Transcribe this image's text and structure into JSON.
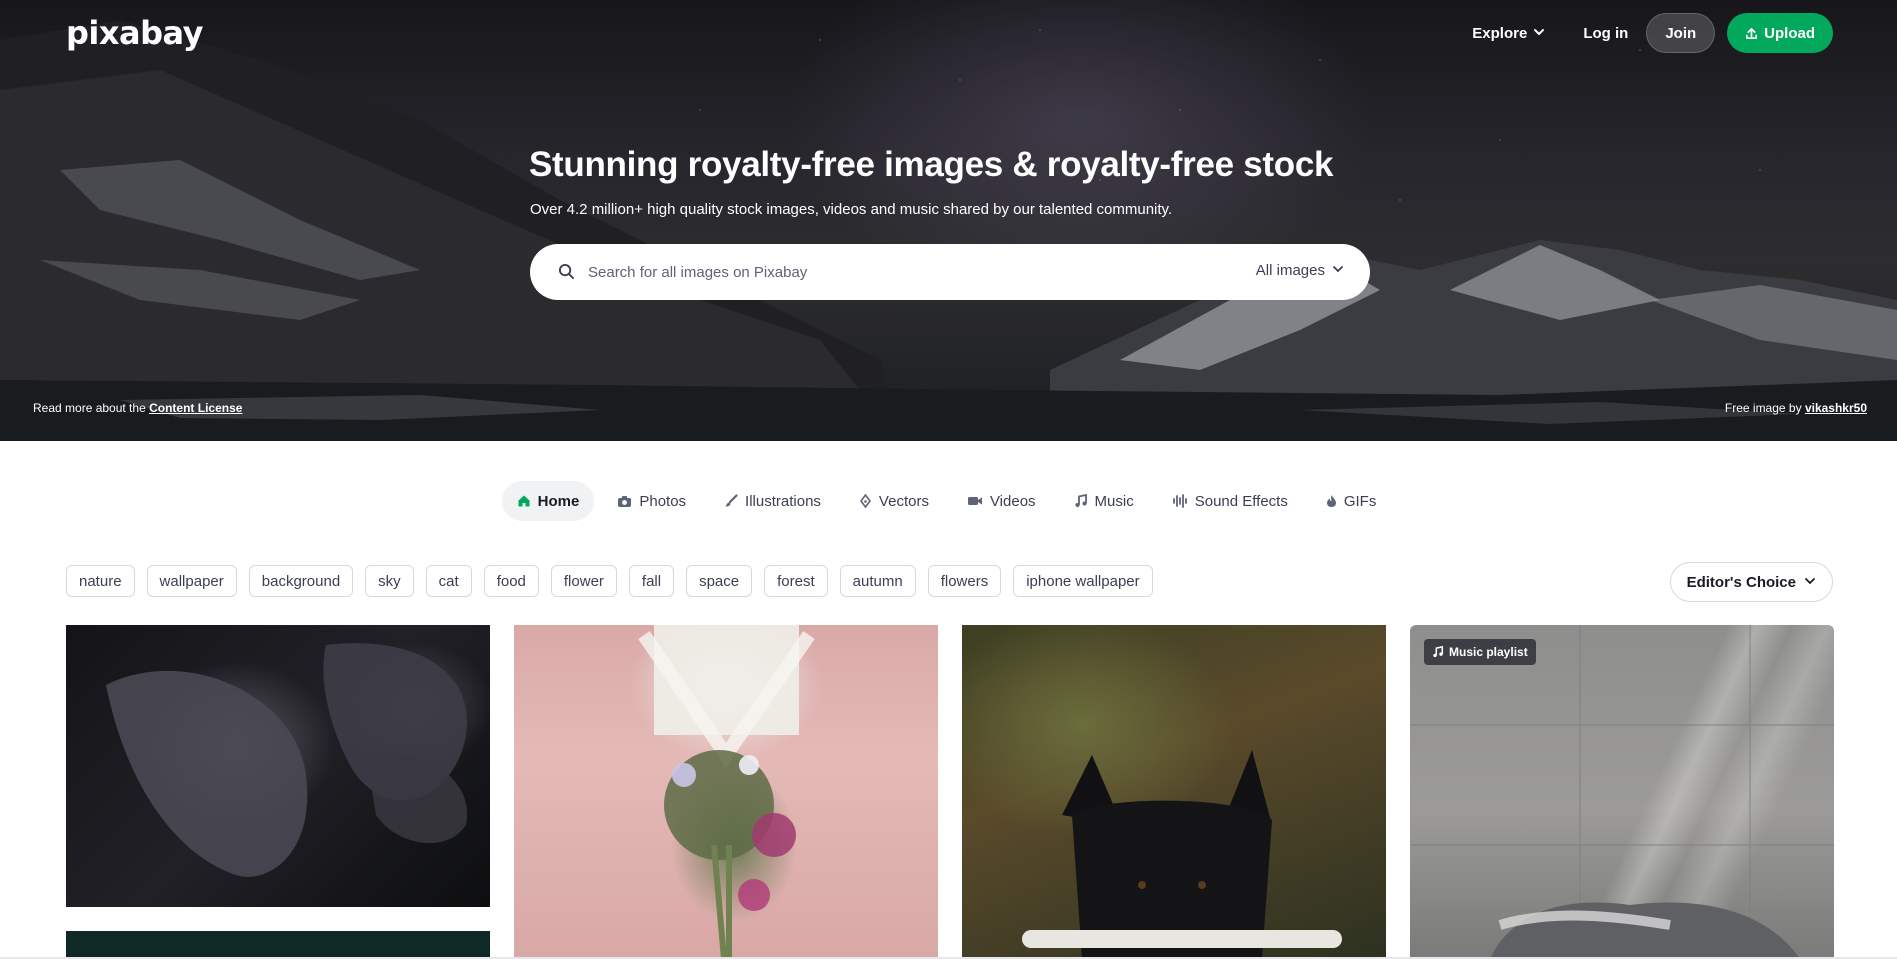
{
  "header": {
    "logo": "pixabay",
    "explore_label": "Explore",
    "login_label": "Log in",
    "join_label": "Join",
    "upload_label": "Upload"
  },
  "hero": {
    "title": "Stunning royalty-free images & royalty-free stock",
    "subtitle": "Over 4.2 million+ high quality stock images, videos and music shared by our talented community.",
    "search_placeholder": "Search for all images on Pixabay",
    "search_scope": "All images",
    "license_prefix": "Read more about the",
    "license_link": "Content License",
    "credit_prefix": "Free image by",
    "credit_link": "vikashkr50"
  },
  "media_tabs": [
    {
      "label": "Home",
      "icon": "home-icon",
      "active": true
    },
    {
      "label": "Photos",
      "icon": "camera-icon",
      "active": false
    },
    {
      "label": "Illustrations",
      "icon": "brush-icon",
      "active": false
    },
    {
      "label": "Vectors",
      "icon": "pen-nib-icon",
      "active": false
    },
    {
      "label": "Videos",
      "icon": "video-camera-icon",
      "active": false
    },
    {
      "label": "Music",
      "icon": "music-note-icon",
      "active": false
    },
    {
      "label": "Sound Effects",
      "icon": "waveform-icon",
      "active": false
    },
    {
      "label": "GIFs",
      "icon": "flame-icon",
      "active": false
    }
  ],
  "tags": [
    "nature",
    "wallpaper",
    "background",
    "sky",
    "cat",
    "food",
    "flower",
    "fall",
    "space",
    "forest",
    "autumn",
    "flowers",
    "iphone wallpaper"
  ],
  "sort": {
    "label": "Editor's Choice"
  },
  "grid": {
    "music_badge": "Music playlist"
  },
  "colors": {
    "accent": "#02a95c",
    "text": "#191b26"
  }
}
